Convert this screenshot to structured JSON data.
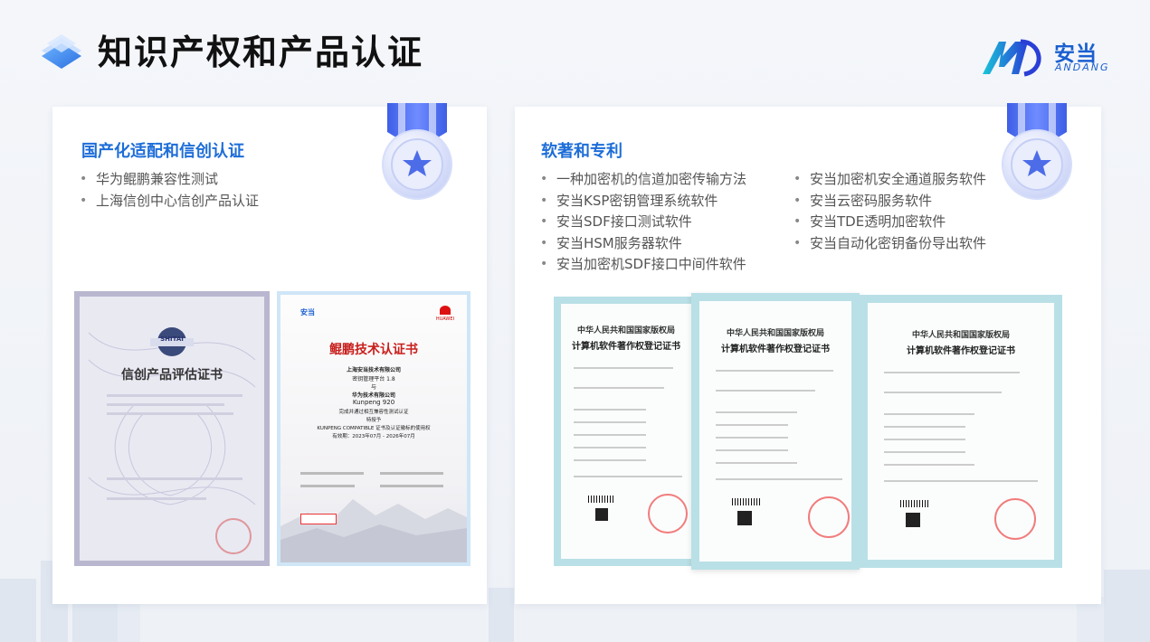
{
  "header": {
    "title": "知识产权和产品认证",
    "brand_cn": "安当",
    "brand_en": "ANDANG",
    "accent_color": "#1d6dd8"
  },
  "left_card": {
    "title": "国产化适配和信创认证",
    "items": [
      "华为鲲鹏兼容性测试",
      "上海信创中心信创产品认证"
    ],
    "medal_icon": "star-medal-icon",
    "cert1": {
      "badge": "SHITAI",
      "title": "信创产品评估证书"
    },
    "cert2": {
      "logo": "安当",
      "huawei": "HUAWEI",
      "title": "鲲鹏技术认证书",
      "company1": "上海安当技术有限公司",
      "product": "密钥管理平台 1.8",
      "and": "与",
      "company2": "华为技术有限公司",
      "platform": "Kunpeng 920",
      "test": "完成并通过相互兼容性测试认证",
      "grant": "特授予",
      "compatible": "KUNPENG COMPATIBLE 证书及认证徽标的使用权",
      "validity": "有效期：2023年07月 - 2026年07月"
    }
  },
  "right_card": {
    "title": "软著和专利",
    "col1": [
      "一种加密机的信道加密传输方法",
      "安当KSP密钥管理系统软件",
      "安当SDF接口测试软件",
      "安当HSM服务器软件",
      "安当加密机SDF接口中间件软件"
    ],
    "col2": [
      "安当加密机安全通道服务软件",
      "安当云密码服务软件",
      "安当TDE透明加密软件",
      "安当自动化密钥备份导出软件"
    ],
    "medal_icon": "star-medal-icon",
    "certs": [
      {
        "issuer": "中华人民共和国国家版权局",
        "title": "计算机软件著作权登记证书"
      },
      {
        "issuer": "中华人民共和国国家版权局",
        "title": "计算机软件著作权登记证书"
      },
      {
        "issuer": "中华人民共和国国家版权局",
        "title": "计算机软件著作权登记证书"
      }
    ]
  }
}
